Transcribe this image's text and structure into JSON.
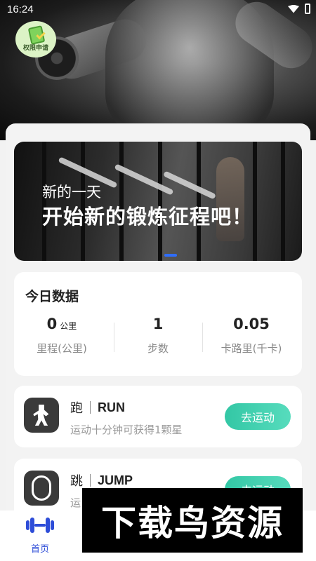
{
  "status_bar": {
    "time": "16:24"
  },
  "hero": {
    "permit_badge_label": "权限申请"
  },
  "banner": {
    "line1": "新的一天",
    "line2": "开始新的锻炼征程吧！"
  },
  "today": {
    "title": "今日数据",
    "stats": [
      {
        "value": "0",
        "unit": "公里",
        "label": "里程(公里)"
      },
      {
        "value": "1",
        "unit": "",
        "label": "步数"
      },
      {
        "value": "0.05",
        "unit": "",
        "label": "卡路里(千卡)"
      }
    ]
  },
  "activities": [
    {
      "cn": "跑",
      "en": "RUN",
      "desc": "运动十分钟可获得1颗星",
      "button": "去运动"
    },
    {
      "cn": "跳",
      "en": "JUMP",
      "desc": "运",
      "button": "去运动"
    }
  ],
  "nav": {
    "home_label": "首页"
  },
  "watermark": {
    "text": "下载鸟资源"
  },
  "colors": {
    "accent": "#2e4dd8",
    "button": "#3ccfad"
  }
}
